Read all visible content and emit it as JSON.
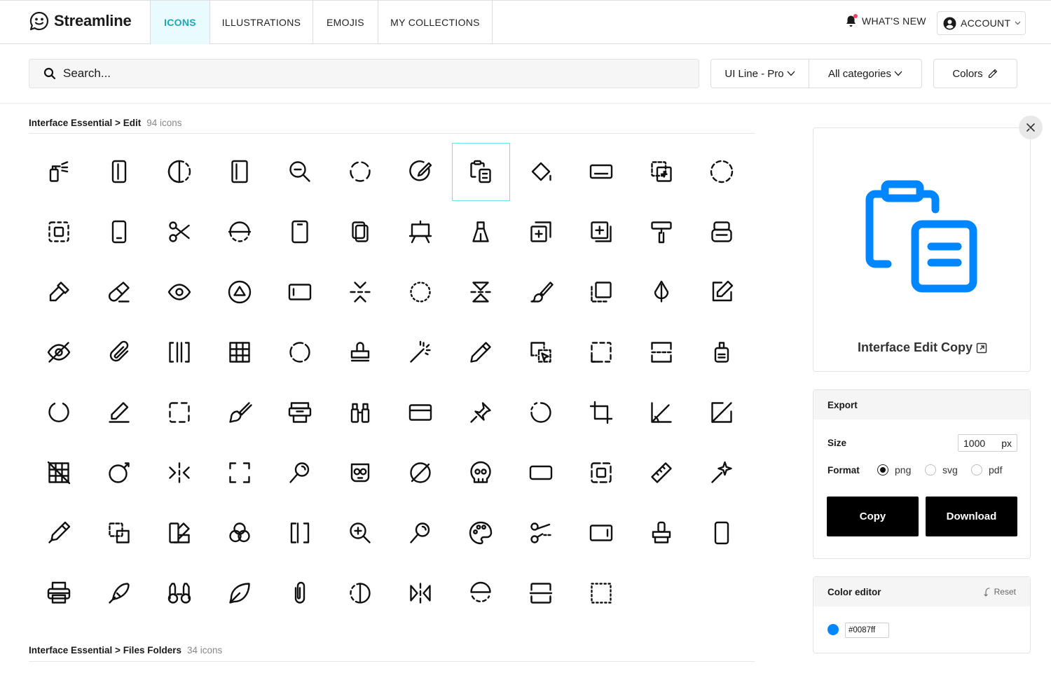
{
  "brand": {
    "name": "Streamline"
  },
  "nav": [
    {
      "label": "ICONS",
      "active": true
    },
    {
      "label": "ILLUSTRATIONS",
      "active": false
    },
    {
      "label": "EMOJIS",
      "active": false
    },
    {
      "label": "MY COLLECTIONS",
      "active": false
    }
  ],
  "header": {
    "whats_new": "WHAT'S NEW",
    "account": "ACCOUNT"
  },
  "search": {
    "placeholder": "Search...",
    "style_filter": "UI Line - Pro",
    "category_filter": "All categories",
    "colors": "Colors"
  },
  "sections": [
    {
      "title": "Interface Essential > Edit",
      "count": "94 icons"
    },
    {
      "title": "Interface Essential > Files Folders",
      "count": "34 icons"
    }
  ],
  "icons": [
    "spray-bottle-icon",
    "phone-portrait-icon",
    "contrast-circle-icon",
    "tablet-portrait-icon",
    "zoom-out-icon",
    "dashed-circle-icon",
    "pencil-circle-icon",
    "clipboard-copy-icon",
    "paint-bucket-icon",
    "rectangle-bar-icon",
    "copy-dashed-square-icon",
    "dashed-circle-thin-icon",
    "dashed-square-target-icon",
    "mobile-phone-icon",
    "scissors-icon",
    "circle-split-icon",
    "tablet-icon",
    "copy-pages-icon",
    "easel-icon",
    "paper-binder-icon",
    "add-layer-icon",
    "add-layer-shadow-icon",
    "paint-roller-icon",
    "stamp-box-icon",
    "eyedropper-icon",
    "eraser-icon",
    "eye-icon",
    "triangle-circle-icon",
    "rectangle-landscape-icon",
    "flip-vertical-icon",
    "dotted-circle-icon",
    "flip-vertical-triangle-icon",
    "brush-icon",
    "dashed-copy-icon",
    "water-drop-icon",
    "edit-square-icon",
    "eye-off-icon",
    "paperclip-icon",
    "bracket-frame-icon",
    "grid-table-icon",
    "circle-dashed-icon",
    "stamp-icon",
    "magic-wand-icon",
    "pencil-icon",
    "select-cursor-dashed-icon",
    "dashed-corners-icon",
    "dashed-split-icon",
    "glue-bottle-icon",
    "circle-gap-icon",
    "pencil-line-icon",
    "dashed-square-icon",
    "paint-brush-icon",
    "printer-stand-icon",
    "crayons-icon",
    "card-rectangle-icon",
    "push-pin-icon",
    "circle-broken-icon",
    "crop-icon",
    "angle-measure-icon",
    "edit-off-icon",
    "grid-off-icon",
    "circle-arrow-icon",
    "flip-horizontal-icon",
    "corners-frame-icon",
    "magnifier-icon",
    "skull-mask-icon",
    "circle-slash-icon",
    "skull-icon",
    "rounded-rectangle-icon",
    "focus-square-icon",
    "ruler-icon",
    "magic-pin-icon",
    "pen-nib-icon",
    "select-drag-icon",
    "color-swatch-icon",
    "color-circles-icon",
    "brackets-icon",
    "zoom-in-icon",
    "search-wand-icon",
    "palette-icon",
    "scissors-cut-icon",
    "tablet-landscape-icon",
    "stamp-tool-icon",
    "phone-outline-icon",
    "printer-icon",
    "quill-pen-icon",
    "binoculars-icon",
    "leaf-pen-icon",
    "paperclip-vertical-icon",
    "half-circle-dashed-icon",
    "mirror-icon",
    "semicircle-split-icon",
    "dashed-rows-icon",
    "dotted-square-icon"
  ],
  "selected_icon_index": 7,
  "preview": {
    "name": "Interface Edit Copy",
    "color": "#0087ff"
  },
  "export": {
    "title": "Export",
    "size_label": "Size",
    "size_value": "1000",
    "size_unit": "px",
    "format_label": "Format",
    "formats": [
      "png",
      "svg",
      "pdf"
    ],
    "selected_format": "png",
    "copy_label": "Copy",
    "download_label": "Download"
  },
  "color_editor": {
    "title": "Color editor",
    "reset_label": "Reset",
    "hex": "#0087ff"
  }
}
